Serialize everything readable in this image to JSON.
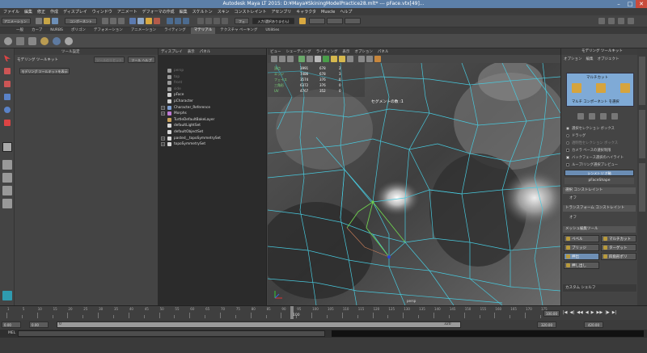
{
  "window": {
    "title": "Autodesk Maya LT 2015: D:¥Maya¥SkiningModelPractice28.mlt* --- pFace.vtx[49]..."
  },
  "menubar": {
    "items": [
      "ファイル",
      "編集",
      "修正",
      "作成",
      "ディスプレイ",
      "ウィンドウ",
      "アニメート",
      "デフォーマの作成",
      "編集",
      "スケルトン",
      "スキン",
      "コンストレイント",
      "アセンブリ",
      "キャラクタ",
      "Muscle",
      "ヘルプ"
    ]
  },
  "status": {
    "mode": "アニメーション",
    "field": "コンポーネント",
    "lang": "フェ",
    "prompt": "入力(選択ありません)"
  },
  "shelf": {
    "tabs": [
      "一般",
      "カーブ",
      "NURBS",
      "ポリゴン",
      "デフォメーション",
      "アニメーション",
      "ライティング",
      "マテリアル",
      "テクスチャ ベーキング",
      "Utilities"
    ],
    "active_index": 7
  },
  "tool_settings": {
    "title": "ツール設定",
    "tool_name": "モデリング ツールキット",
    "reset_button": "ツールのリセット",
    "help_button": "ツール ヘルプ",
    "action_button": "モデリング ツールキットを表示"
  },
  "outliner": {
    "menu": [
      "ディスプレイ",
      "表示",
      "パネル"
    ],
    "items": [
      {
        "label": "persp",
        "dim": true,
        "expand": false
      },
      {
        "label": "top",
        "dim": true,
        "expand": false
      },
      {
        "label": "front",
        "dim": true,
        "expand": false
      },
      {
        "label": "side",
        "dim": true,
        "expand": false
      },
      {
        "label": "pFace",
        "dim": false,
        "expand": false
      },
      {
        "label": "pCharacter",
        "dim": false,
        "expand": false
      },
      {
        "label": "Character_Reference",
        "dim": false,
        "expand": true
      },
      {
        "label": "Morphs",
        "dim": false,
        "expand": true
      },
      {
        "label": "TurtleDefaultBakeLayer",
        "dim": false,
        "expand": false
      },
      {
        "label": "defaultLightSet",
        "dim": false,
        "expand": false
      },
      {
        "label": "defaultObjectSet",
        "dim": false,
        "expand": false
      },
      {
        "label": "pasted__topoSymmetrySet",
        "dim": false,
        "expand": true
      },
      {
        "label": "topoSymmetrySet",
        "dim": false,
        "expand": true
      }
    ]
  },
  "viewport": {
    "menu": [
      "ビュー",
      "シェーディング",
      "ライティング",
      "表示",
      "オプション",
      "パネル"
    ],
    "hud": {
      "labels": [
        "頂点",
        "エッジ",
        "フェイス",
        "三角形",
        "UV"
      ],
      "values": [
        [
          "3991",
          "678",
          "2"
        ],
        [
          "7486",
          "678",
          "3"
        ],
        [
          "3574",
          "376",
          "0"
        ],
        [
          "6372",
          "376",
          "0"
        ],
        [
          "4767",
          "352",
          "0"
        ]
      ]
    },
    "segment_label": "セグメントの数 :1",
    "axis_label": "persp"
  },
  "modeling": {
    "title": "モデリング ツールキット",
    "menu": [
      "オプション",
      "編集",
      "オブジェクト"
    ],
    "icon_label": "マルチカット",
    "component_label": "マルチ コンポーネント を選択",
    "options": [
      {
        "label": "選択セレクション ボックス",
        "type": "radio",
        "on": true,
        "dim": false
      },
      {
        "label": "ドラッグ",
        "type": "radio",
        "on": false,
        "dim": false
      },
      {
        "label": "透明性セレクション ボックス",
        "type": "radio",
        "on": false,
        "dim": true
      },
      {
        "label": "カメラ ベースの選択制限",
        "type": "check",
        "on": false,
        "dim": false
      },
      {
        "label": "バックフェース選択のハイライト",
        "type": "check",
        "on": true,
        "dim": false
      },
      {
        "label": "ループ/リング選択プレビュー",
        "type": "check",
        "on": false,
        "dim": false
      }
    ],
    "symmetry_button": "シンメトリ:オ軸",
    "shape_name": "pFaceShape",
    "constraint_header": "選択 コンストレイント",
    "constraint_value": "オフ",
    "transform_header": "トランスフォーム コンストレイント",
    "transform_value": "オフ",
    "mesh_header": "メッシュ編集ツール",
    "mesh_tools": [
      [
        "ベベル",
        "マルチカット"
      ],
      [
        "ブリッジ",
        "ターゲット"
      ],
      [
        "押出",
        "四角形ポリ"
      ],
      [
        "押し出し",
        ""
      ]
    ],
    "mesh_active": [
      2,
      0
    ],
    "custom_shelf": "カスタム シェルフ"
  },
  "timeslider": {
    "ticks": [
      "1",
      "5",
      "10",
      "15",
      "20",
      "25",
      "30",
      "35",
      "40",
      "45",
      "50",
      "55",
      "60",
      "65",
      "70",
      "75",
      "80",
      "85",
      "90",
      "95",
      "100",
      "105",
      "110",
      "115",
      "120",
      "125",
      "130",
      "135",
      "140",
      "145",
      "150",
      "155",
      "160",
      "165",
      "170",
      "175"
    ],
    "current": "100",
    "end": "100.00"
  },
  "range": {
    "start": "0.00",
    "start2": "0.00",
    "mid": "0",
    "end_marker": "320",
    "range_end": "320.00",
    "total": "420.00"
  },
  "cmdline": {
    "label": "MEL"
  }
}
